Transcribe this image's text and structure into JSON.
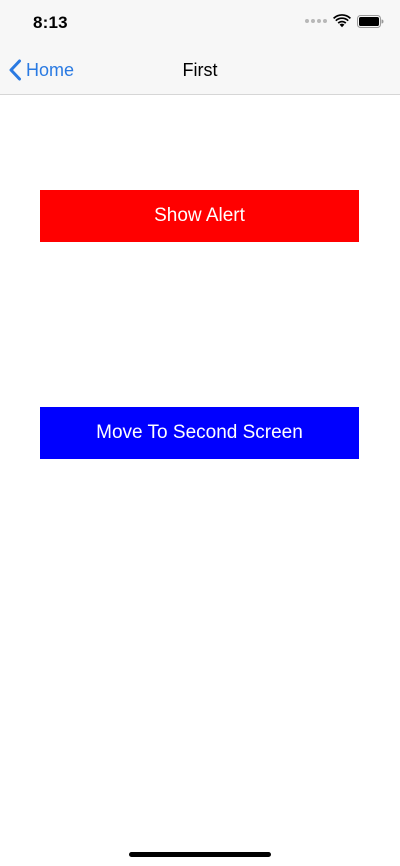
{
  "status_bar": {
    "time": "8:13",
    "icons": [
      "signal-dots-icon",
      "wifi-icon",
      "battery-icon"
    ]
  },
  "nav": {
    "back_label": "Home",
    "title": "First",
    "accent_color": "#2a7ae2"
  },
  "buttons": {
    "show_alert": {
      "label": "Show Alert",
      "color": "#ff0000"
    },
    "move_to_second": {
      "label": "Move To Second Screen",
      "color": "#0000ff"
    }
  }
}
